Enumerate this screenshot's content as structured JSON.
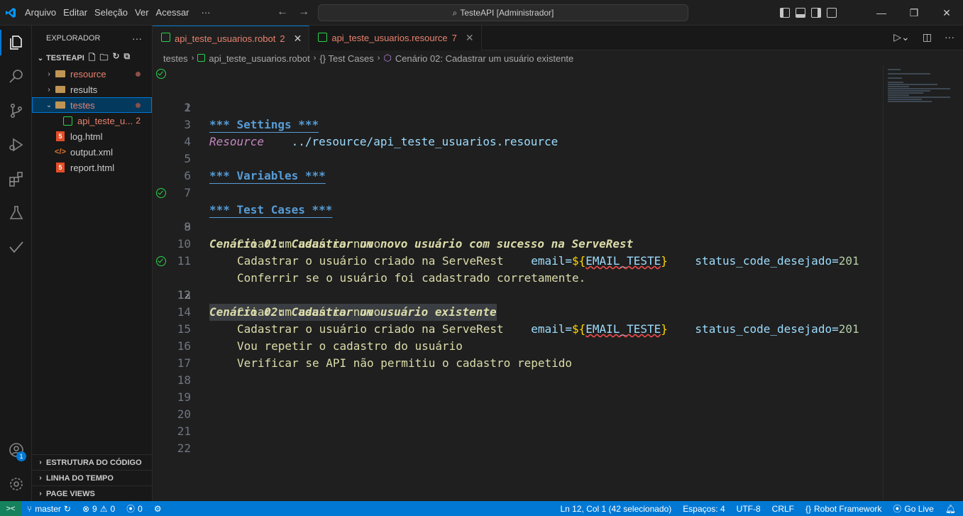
{
  "titlebar": {
    "menu": [
      "Arquivo",
      "Editar",
      "Seleção",
      "Ver",
      "Acessar",
      "···"
    ],
    "search_text": "TesteAPI [Administrador]"
  },
  "sidebar": {
    "title": "EXPLORADOR",
    "more": "···",
    "root_folder": "TESTEAPI",
    "tree": [
      {
        "label": "resource",
        "type": "folder",
        "modified": true
      },
      {
        "label": "results",
        "type": "folder",
        "modified": false
      },
      {
        "label": "testes",
        "type": "folder",
        "modified": true
      },
      {
        "label": "api_teste_u...",
        "type": "robot",
        "problems": "2"
      },
      {
        "label": "log.html",
        "type": "html"
      },
      {
        "label": "output.xml",
        "type": "xml"
      },
      {
        "label": "report.html",
        "type": "html"
      }
    ],
    "panels": [
      "ESTRUTURA DO CÓDIGO",
      "LINHA DO TEMPO",
      "PAGE VIEWS"
    ]
  },
  "tabs": [
    {
      "label": "api_teste_usuarios.robot",
      "problems": "2",
      "active": true
    },
    {
      "label": "api_teste_usuarios.resource",
      "problems": "7",
      "active": false
    }
  ],
  "breadcrumb": {
    "folder": "testes",
    "file": "api_teste_usuarios.robot",
    "section": "{} Test Cases",
    "symbol": "Cenário 02: Cadastrar um usuário existente"
  },
  "editor": {
    "line_numbers": [
      "1",
      "2",
      "3",
      "4",
      "5",
      "6",
      "7",
      "8",
      "9",
      "10",
      "11",
      "12",
      "13",
      "14",
      "15",
      "16",
      "17",
      "18",
      "19",
      "20",
      "21",
      "22"
    ],
    "settings_header": "*** Settings ***",
    "resource_keyword": "Resource",
    "resource_path": "../resource/api_teste_usuarios.resource",
    "variables_header": "*** Variables ***",
    "testcases_header": "*** Test Cases ***",
    "tc1_name": "Cenário 01: Cadastrar um novo usuário com sucesso na ServeRest",
    "tc1_step1": "Criar um usuário novo",
    "tc1_step2": "Cadastrar o usuário criado na ServeRest",
    "tc1_step3": "Conferrir se o usuário foi cadastrado corretamente.",
    "tc2_name": "Cenário 02: Cadastrar um usuário existente",
    "tc2_step1": "Criar um usuário novo",
    "tc2_step2": "Cadastrar o usuário criado na ServeRest",
    "tc2_step3": "Vou repetir o cadastro do usuário",
    "tc2_step4": "Verificar se API não permitiu o cadastro repetido",
    "arg_email": "email=",
    "var_open": "${",
    "var_name": "EMAIL_TESTE",
    "var_close": "}",
    "arg_status": "status_code_desejado=",
    "status_value": "201"
  },
  "statusbar": {
    "branch": "master",
    "errors": "9",
    "warnings": "0",
    "ports": "0",
    "position": "Ln 12, Col 1 (42 selecionado)",
    "spaces": "Espaços: 4",
    "encoding": "UTF-8",
    "eol": "CRLF",
    "language": "Robot Framework",
    "golive": "Go Live"
  },
  "accounts_badge": "1",
  "colors": {
    "accent": "#0078d4",
    "modified": "#e9826e",
    "passed": "#2bd34a"
  }
}
